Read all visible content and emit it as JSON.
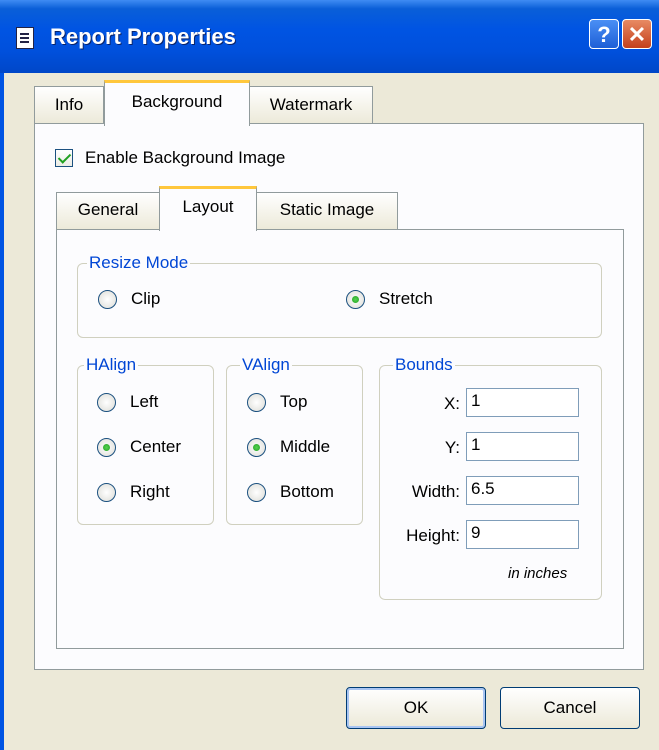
{
  "window": {
    "title": "Report Properties",
    "help_label": "?",
    "close_label": "✕"
  },
  "tabs": [
    {
      "label": "Info",
      "selected": false
    },
    {
      "label": "Background",
      "selected": true
    },
    {
      "label": "Watermark",
      "selected": false
    }
  ],
  "enable_background": {
    "label": "Enable Background Image",
    "checked": true
  },
  "subtabs": [
    {
      "label": "General",
      "selected": false
    },
    {
      "label": "Layout",
      "selected": true
    },
    {
      "label": "Static Image",
      "selected": false
    }
  ],
  "resize_mode": {
    "legend": "Resize Mode",
    "options": [
      {
        "label": "Clip",
        "selected": false
      },
      {
        "label": "Stretch",
        "selected": true
      }
    ]
  },
  "halign": {
    "legend": "HAlign",
    "options": [
      {
        "label": "Left",
        "selected": false
      },
      {
        "label": "Center",
        "selected": true
      },
      {
        "label": "Right",
        "selected": false
      }
    ]
  },
  "valign": {
    "legend": "VAlign",
    "options": [
      {
        "label": "Top",
        "selected": false
      },
      {
        "label": "Middle",
        "selected": true
      },
      {
        "label": "Bottom",
        "selected": false
      }
    ]
  },
  "bounds": {
    "legend": "Bounds",
    "fields": [
      {
        "label": "X:",
        "value": "1"
      },
      {
        "label": "Y:",
        "value": "1"
      },
      {
        "label": "Width:",
        "value": "6.5"
      },
      {
        "label": "Height:",
        "value": "9"
      }
    ],
    "units_note": "in inches"
  },
  "buttons": {
    "ok_label": "OK",
    "cancel_label": "Cancel"
  }
}
